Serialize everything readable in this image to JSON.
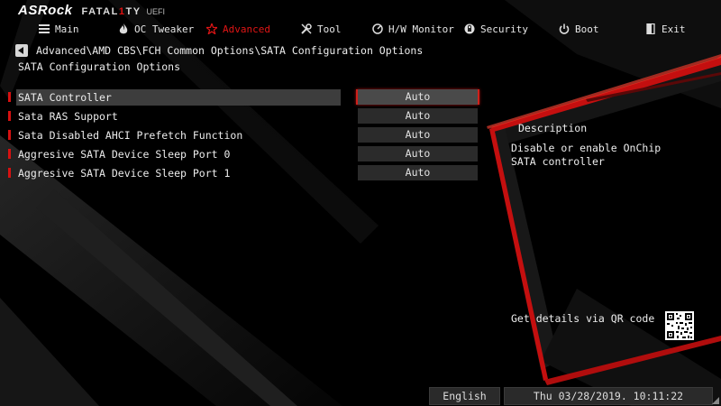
{
  "brand": {
    "name": "ASRock",
    "series": "FATAL1TY",
    "suffix": "UEFI"
  },
  "menu": [
    {
      "label": "Main",
      "icon": "list-icon",
      "active": false
    },
    {
      "label": "OC Tweaker",
      "icon": "flame-icon",
      "active": false
    },
    {
      "label": "Advanced",
      "icon": "star-icon",
      "active": true
    },
    {
      "label": "Tool",
      "icon": "tools-icon",
      "active": false
    },
    {
      "label": "H/W Monitor",
      "icon": "monitor-icon",
      "active": false
    },
    {
      "label": "Security",
      "icon": "shield-icon",
      "active": false
    },
    {
      "label": "Boot",
      "icon": "power-icon",
      "active": false
    },
    {
      "label": "Exit",
      "icon": "exit-icon",
      "active": false
    }
  ],
  "breadcrumb": "Advanced\\AMD CBS\\FCH Common Options\\SATA Configuration Options",
  "page_title": "SATA Configuration Options",
  "settings": [
    {
      "label": "SATA Controller",
      "value": "Auto",
      "selected": true
    },
    {
      "label": "Sata RAS Support",
      "value": "Auto",
      "selected": false
    },
    {
      "label": "Sata Disabled AHCI Prefetch Function",
      "value": "Auto",
      "selected": false
    },
    {
      "label": "Aggresive SATA Device Sleep Port 0",
      "value": "Auto",
      "selected": false
    },
    {
      "label": "Aggresive SATA Device Sleep Port 1",
      "value": "Auto",
      "selected": false
    }
  ],
  "description": {
    "title": "Description",
    "text": "Disable or enable OnChip SATA controller"
  },
  "qr_caption": "Get details via QR code",
  "footer": {
    "language": "English",
    "datetime": "Thu 03/28/2019. 10:11:22"
  },
  "colors": {
    "accent": "#e01515",
    "background": "#000000",
    "selected_row": "#3d3d3d",
    "value_box": "#2b2b2b"
  }
}
